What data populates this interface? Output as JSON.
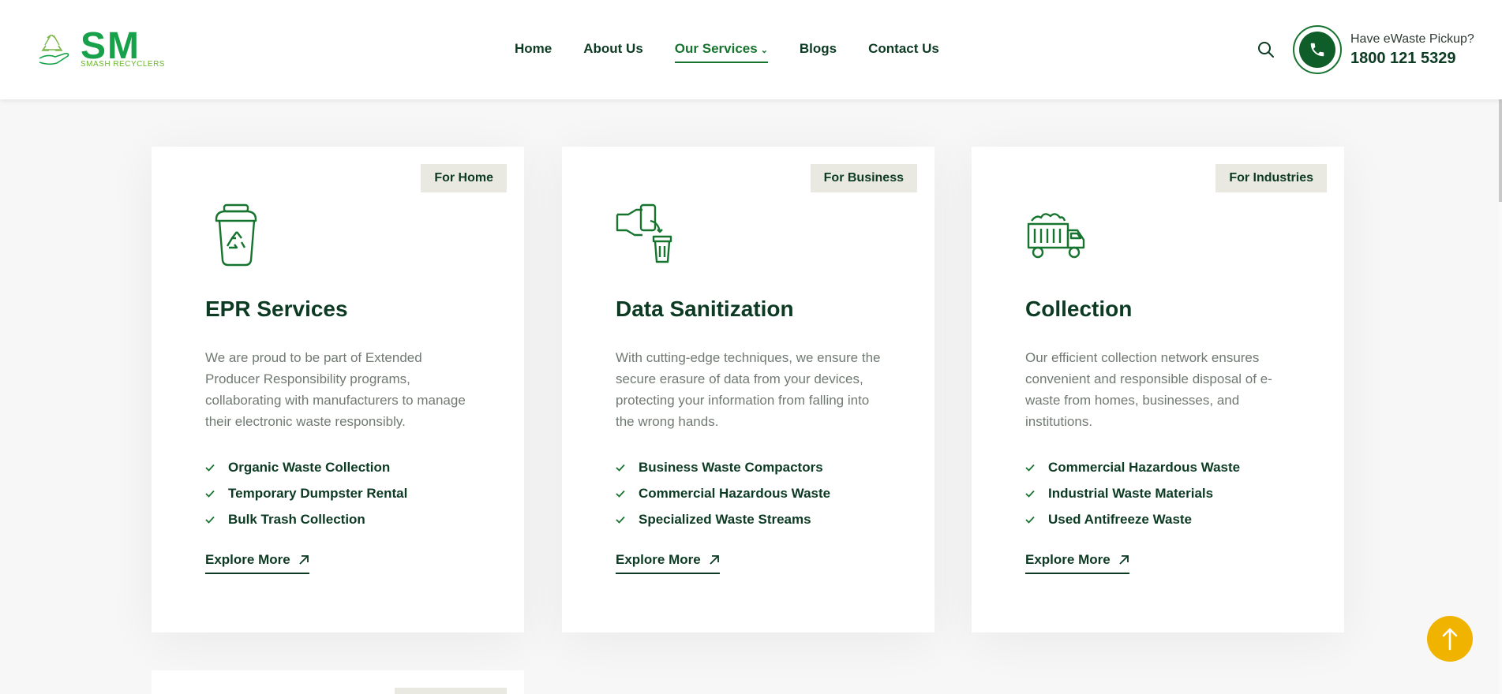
{
  "brand": {
    "logo_text": "SM",
    "logo_subtitle": "SMASH RECYCLERS"
  },
  "nav": {
    "items": [
      {
        "label": "Home",
        "active": false
      },
      {
        "label": "About Us",
        "active": false
      },
      {
        "label": "Our Services",
        "active": true,
        "dropdown": true
      },
      {
        "label": "Blogs",
        "active": false
      },
      {
        "label": "Contact Us",
        "active": false
      }
    ]
  },
  "header": {
    "pickup_label": "Have eWaste Pickup?",
    "pickup_number": "1800 121 5329"
  },
  "cards": [
    {
      "badge": "For Home",
      "icon": "recycle-bin-icon",
      "title": "EPR Services",
      "description": "We are proud to be part of Extended Producer Responsibility programs, collaborating with manufacturers to manage their electronic waste responsibly.",
      "features": [
        "Organic Waste Collection",
        "Temporary Dumpster Rental",
        "Bulk Trash Collection"
      ],
      "link": "Explore More"
    },
    {
      "badge": "For Business",
      "icon": "phone-to-bin-icon",
      "title": "Data Sanitization",
      "description": "With cutting-edge techniques, we ensure the secure erasure of data from your devices, protecting your information from falling into the wrong hands.",
      "features": [
        "Business Waste Compactors",
        "Commercial Hazardous Waste",
        "Specialized Waste Streams"
      ],
      "link": "Explore More"
    },
    {
      "badge": "For Industries",
      "icon": "garbage-truck-icon",
      "title": "Collection",
      "description": "Our efficient collection network ensures convenient and responsible disposal of e-waste from homes, businesses, and institutions.",
      "features": [
        "Commercial Hazardous Waste",
        "Industrial Waste Materials",
        "Used Antifreeze Waste"
      ],
      "link": "Explore More"
    }
  ],
  "colors": {
    "brand_green": "#17a14a",
    "dark_green": "#0c3a22",
    "accent_yellow": "#f0b400",
    "badge_bg": "#e9e9e2"
  }
}
